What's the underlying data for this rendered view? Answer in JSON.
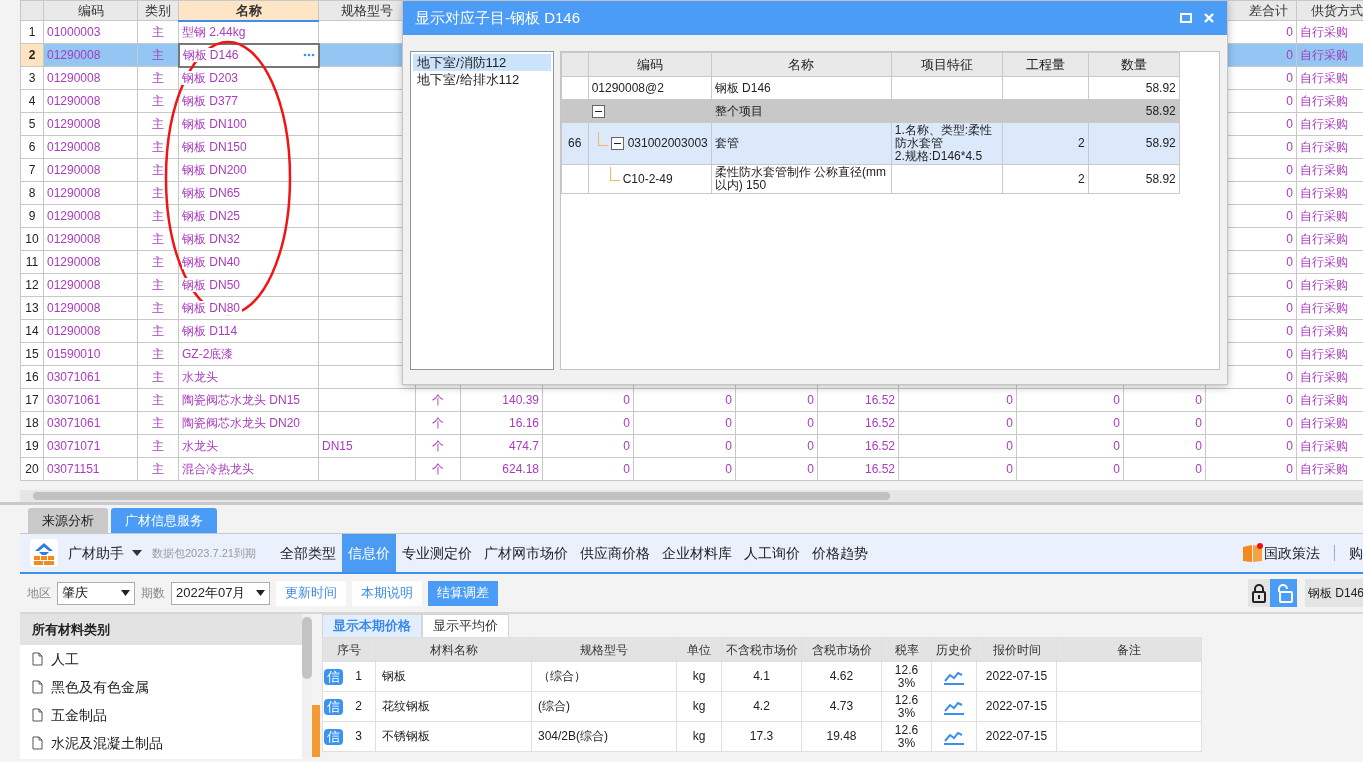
{
  "grid": {
    "columns": [
      {
        "label": "编码",
        "selected": false
      },
      {
        "label": "类别",
        "selected": false
      },
      {
        "label": "名称",
        "selected": true
      },
      {
        "label": "规格型号",
        "selected": false
      },
      {
        "label": "差合计",
        "selected": false
      },
      {
        "label": "供货方式",
        "selected": false
      }
    ],
    "rows": [
      {
        "no": "1",
        "code": "01000003",
        "type": "主",
        "name": "型钢 2.44kg",
        "price_diff_total": "0",
        "supply": "自行采购",
        "selected": false
      },
      {
        "no": "2",
        "code": "01290008",
        "type": "主",
        "name": "钢板 D146",
        "price_diff_total": "0",
        "supply": "自行采购",
        "selected": true
      },
      {
        "no": "3",
        "code": "01290008",
        "type": "主",
        "name": "钢板 D203",
        "price_diff_total": "0",
        "supply": "自行采购",
        "selected": false
      },
      {
        "no": "4",
        "code": "01290008",
        "type": "主",
        "name": "钢板 D377",
        "price_diff_total": "0",
        "supply": "自行采购",
        "selected": false
      },
      {
        "no": "5",
        "code": "01290008",
        "type": "主",
        "name": "钢板 DN100",
        "price_diff_total": "0",
        "supply": "自行采购",
        "selected": false
      },
      {
        "no": "6",
        "code": "01290008",
        "type": "主",
        "name": "钢板 DN150",
        "price_diff_total": "0",
        "supply": "自行采购",
        "selected": false
      },
      {
        "no": "7",
        "code": "01290008",
        "type": "主",
        "name": "钢板 DN200",
        "price_diff_total": "0",
        "supply": "自行采购",
        "selected": false
      },
      {
        "no": "8",
        "code": "01290008",
        "type": "主",
        "name": "钢板 DN65",
        "price_diff_total": "0",
        "supply": "自行采购",
        "selected": false
      },
      {
        "no": "9",
        "code": "01290008",
        "type": "主",
        "name": "钢板 DN25",
        "price_diff_total": "0",
        "supply": "自行采购",
        "selected": false
      },
      {
        "no": "10",
        "code": "01290008",
        "type": "主",
        "name": "钢板 DN32",
        "price_diff_total": "0",
        "supply": "自行采购",
        "selected": false
      },
      {
        "no": "11",
        "code": "01290008",
        "type": "主",
        "name": "钢板 DN40",
        "price_diff_total": "0",
        "supply": "自行采购",
        "selected": false
      },
      {
        "no": "12",
        "code": "01290008",
        "type": "主",
        "name": "钢板 DN50",
        "price_diff_total": "0",
        "supply": "自行采购",
        "selected": false
      },
      {
        "no": "13",
        "code": "01290008",
        "type": "主",
        "name": "钢板 DN80",
        "price_diff_total": "0",
        "supply": "自行采购",
        "selected": false
      },
      {
        "no": "14",
        "code": "01290008",
        "type": "主",
        "name": "钢板 D114",
        "price_diff_total": "0",
        "supply": "自行采购",
        "selected": false
      },
      {
        "no": "15",
        "code": "01590010",
        "type": "主",
        "name": "GZ-2底漆",
        "price_diff_total": "0",
        "supply": "自行采购",
        "selected": false
      },
      {
        "no": "16",
        "code": "03071061",
        "type": "主",
        "name": "水龙头",
        "price_diff_total": "0",
        "supply": "自行采购",
        "selected": false
      },
      {
        "no": "17",
        "code": "03071061",
        "type": "主",
        "name": "陶瓷阀芯水龙头 DN15",
        "unit": "个",
        "values": [
          "140.39",
          "0",
          "0",
          "0",
          "16.52",
          "0",
          "0",
          "0"
        ],
        "price_diff_total": "0",
        "supply": "自行采购",
        "selected": false
      },
      {
        "no": "18",
        "code": "03071061",
        "type": "主",
        "name": "陶瓷阀芯水龙头 DN20",
        "unit": "个",
        "values": [
          "16.16",
          "0",
          "0",
          "0",
          "16.52",
          "0",
          "0",
          "0"
        ],
        "price_diff_total": "0",
        "supply": "自行采购",
        "selected": false
      },
      {
        "no": "19",
        "code": "03071071",
        "type": "主",
        "name": "水龙头",
        "spec": "DN15",
        "unit": "个",
        "values": [
          "474.7",
          "0",
          "0",
          "0",
          "16.52",
          "0",
          "0",
          "0"
        ],
        "price_diff_total": "0",
        "supply": "自行采购",
        "selected": false
      },
      {
        "no": "20",
        "code": "03071151",
        "type": "主",
        "name": "混合冷热龙头",
        "unit": "个",
        "values": [
          "624.18",
          "0",
          "0",
          "0",
          "16.52",
          "0",
          "0",
          "0"
        ],
        "price_diff_total": "0",
        "supply": "自行采购",
        "selected": false
      }
    ]
  },
  "dialog": {
    "title": "显示对应子目-钢板 D146",
    "locations": [
      {
        "label": "地下室/消防112",
        "selected": true
      },
      {
        "label": "地下室/给排水112",
        "selected": false
      }
    ],
    "columns": {
      "code": "编码",
      "name": "名称",
      "feature": "项目特征",
      "quantity": "工程量",
      "amount": "数量"
    },
    "rows": [
      {
        "kind": "material",
        "code": "01290008@2",
        "name": "钢板 D146",
        "amount": "58.92",
        "selected": false
      },
      {
        "kind": "group",
        "name": "整个项目",
        "amount": "58.92",
        "selected": false,
        "expanded": true,
        "children": [
          {
            "kind": "item",
            "no": "66",
            "code": "031002003003",
            "name": "套管",
            "feature": "1.名称、类型:柔性防水套管\n2.规格:D146*4.5",
            "quantity": "2",
            "amount": "58.92",
            "selected": true,
            "expanded": true,
            "children": [
              {
                "kind": "quota",
                "code": "C10-2-49",
                "name": "柔性防水套管制作 公称直径(mm以内) 150",
                "quantity": "2",
                "amount": "58.92",
                "selected": false
              }
            ]
          }
        ]
      }
    ]
  },
  "panel_tabs": [
    {
      "label": "来源分析",
      "selected": false
    },
    {
      "label": "广材信息服务",
      "selected": true
    }
  ],
  "toolbar": {
    "app_name": "广材助手",
    "package": "数据包2023.7.21到期",
    "nav": [
      {
        "label": "全部类型",
        "selected": false
      },
      {
        "label": "信息价",
        "selected": true
      },
      {
        "label": "专业测定价",
        "selected": false
      },
      {
        "label": "广材网市场价",
        "selected": false
      },
      {
        "label": "供应商价格",
        "selected": false
      },
      {
        "label": "企业材料库",
        "selected": false
      },
      {
        "label": "人工询价",
        "selected": false
      },
      {
        "label": "价格趋势",
        "selected": false
      }
    ],
    "policy_link": "国政策法",
    "buy_link": "购"
  },
  "filters": {
    "region_label": "地区",
    "region": "肇庆",
    "period_label": "期数",
    "period": "2022年07月",
    "buttons": [
      {
        "label": "更新时间",
        "kind": "plain"
      },
      {
        "label": "本期说明",
        "kind": "plain"
      },
      {
        "label": "结算调差",
        "kind": "primary"
      }
    ],
    "locked": false,
    "search_value": "钢板 D146"
  },
  "categories": {
    "title": "所有材料类别",
    "items": [
      "人工",
      "黑色及有色金属",
      "五金制品",
      "水泥及混凝土制品"
    ]
  },
  "price_tabs": [
    {
      "label": "显示本期价格",
      "selected": true
    },
    {
      "label": "显示平均价",
      "selected": false
    }
  ],
  "price_table": {
    "columns": [
      "序号",
      "材料名称",
      "规格型号",
      "单位",
      "不含税市场价",
      "含税市场价",
      "税率",
      "历史价",
      "报价时间",
      "备注"
    ],
    "rows": [
      {
        "badge": "信",
        "no": "1",
        "name": "钢板",
        "spec": "（综合）",
        "unit": "kg",
        "price_ex_tax": "4.1",
        "price_inc_tax": "4.62",
        "tax_rate": "12.63%",
        "date": "2022-07-15"
      },
      {
        "badge": "信",
        "no": "2",
        "name": "花纹钢板",
        "spec": "(综合)",
        "unit": "kg",
        "price_ex_tax": "4.2",
        "price_inc_tax": "4.73",
        "tax_rate": "12.63%",
        "date": "2022-07-15"
      },
      {
        "badge": "信",
        "no": "3",
        "name": "不锈钢板",
        "spec": "304/2B(综合)",
        "unit": "kg",
        "price_ex_tax": "17.3",
        "price_inc_tax": "19.48",
        "tax_rate": "12.63%",
        "date": "2022-07-15"
      }
    ]
  }
}
